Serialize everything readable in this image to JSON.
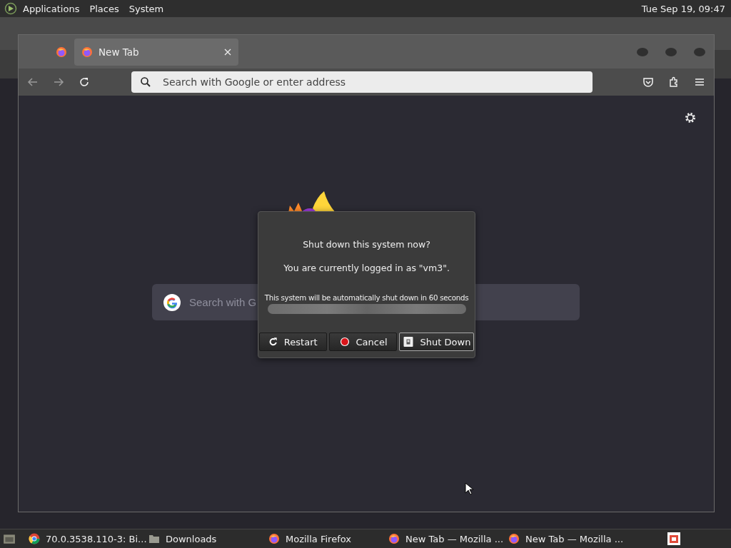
{
  "top_panel": {
    "menus": [
      {
        "label": "Applications"
      },
      {
        "label": "Places"
      },
      {
        "label": "System"
      }
    ],
    "clock": "Tue Sep 19, 09:47"
  },
  "browser": {
    "tabs": [
      {
        "label": "New Tab",
        "selected": true
      }
    ],
    "address": {
      "placeholder": "Search with Google or enter address"
    },
    "content_search": {
      "placeholder": "Search with G"
    }
  },
  "dialog": {
    "title": "Shut down this system now?",
    "message": "You are currently logged in as \"vm3\".",
    "countdown": "This system will be automatically shut down in 60 seconds",
    "progress": {
      "level": 1
    },
    "buttons": [
      {
        "kind": "restart",
        "label": "Restart",
        "selected": false
      },
      {
        "kind": "cancel",
        "label": "Cancel",
        "selected": false
      },
      {
        "kind": "shutdown",
        "label": "Shut Down",
        "selected": true
      }
    ]
  },
  "taskbar": {
    "items": [
      {
        "kind": "chrome",
        "label": "70.0.3538.110-3: Bi..."
      },
      {
        "kind": "folder",
        "label": "Downloads"
      },
      {
        "kind": "firefox",
        "label": "Mozilla Firefox"
      },
      {
        "kind": "firefox",
        "label": "New Tab — Mozilla ..."
      },
      {
        "kind": "firefox",
        "label": "New Tab — Mozilla ..."
      }
    ]
  }
}
